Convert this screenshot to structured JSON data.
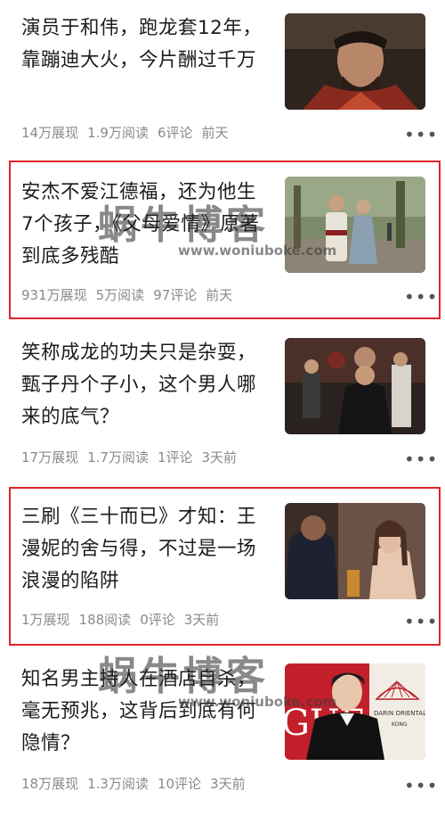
{
  "articles": [
    {
      "title": "演员于和伟，跑龙套12年，靠蹦迪大火，今片酬过千万",
      "impressions": "14万展现",
      "reads": "1.9万阅读",
      "comments": "6评论",
      "time": "前天",
      "more": "•••",
      "highlighted": false
    },
    {
      "title": "安杰不爱江德福，还为他生7个孩子，《父母爱情》原著到底多残酷",
      "impressions": "931万展现",
      "reads": "5万阅读",
      "comments": "97评论",
      "time": "前天",
      "more": "•••",
      "highlighted": true
    },
    {
      "title": "笑称成龙的功夫只是杂耍，甄子丹个子小，这个男人哪来的底气？",
      "impressions": "17万展现",
      "reads": "1.7万阅读",
      "comments": "1评论",
      "time": "3天前",
      "more": "•••",
      "highlighted": false
    },
    {
      "title": "三刷《三十而已》才知：王漫妮的舍与得，不过是一场浪漫的陷阱",
      "impressions": "1万展现",
      "reads": "188阅读",
      "comments": "0评论",
      "time": "3天前",
      "more": "•••",
      "highlighted": true
    },
    {
      "title": "知名男主持人在酒店自杀，毫无预兆，这背后到底有何隐情？",
      "impressions": "18万展现",
      "reads": "1.3万阅读",
      "comments": "10评论",
      "time": "3天前",
      "more": "•••",
      "highlighted": false
    }
  ],
  "watermark": {
    "text": "蜗牛博客",
    "url": "www.woniuboke.com"
  },
  "thumb_texts": {
    "poster_text": "GUE",
    "poster_sub": "DARIN ORIENTAL",
    "poster_sub2": "KONG"
  },
  "colors": {
    "highlight_border": "#e0242b",
    "meta_text": "#8a8a8a",
    "title_text": "#1c1c1c"
  }
}
